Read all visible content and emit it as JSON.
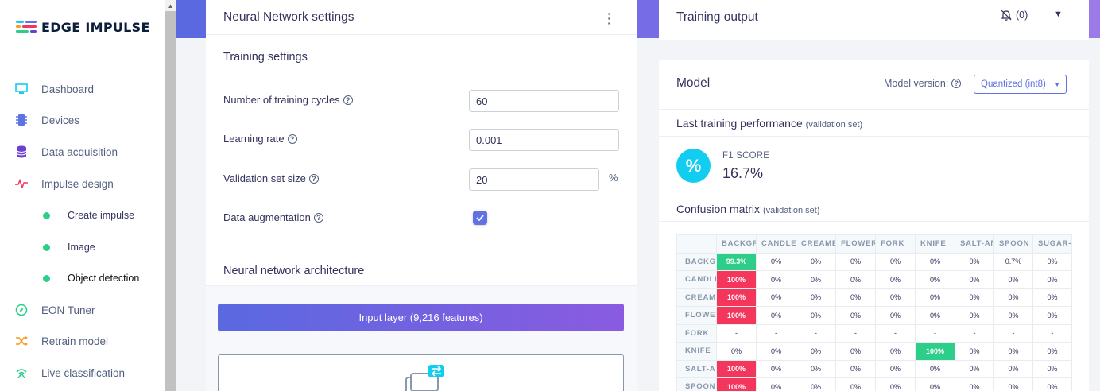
{
  "brand": {
    "name": "EDGE IMPULSE"
  },
  "sidebar": {
    "items": [
      {
        "label": "Dashboard",
        "icon": "monitor-icon",
        "color": "#11cdef"
      },
      {
        "label": "Devices",
        "icon": "chip-icon",
        "color": "#5e72e4"
      },
      {
        "label": "Data acquisition",
        "icon": "database-icon",
        "color": "#6b3fd4"
      },
      {
        "label": "Impulse design",
        "icon": "pulse-icon",
        "color": "#f5365c"
      },
      {
        "label": "Create impulse",
        "sub": true
      },
      {
        "label": "Image",
        "sub": true
      },
      {
        "label": "Object detection",
        "sub": true,
        "active": true
      },
      {
        "label": "EON Tuner",
        "icon": "compass-icon",
        "color": "#2dce89"
      },
      {
        "label": "Retrain model",
        "icon": "shuffle-icon",
        "color": "#fb9a20"
      },
      {
        "label": "Live classification",
        "icon": "signal-icon",
        "color": "#2dce89"
      }
    ]
  },
  "nn": {
    "title": "Neural Network settings",
    "training_settings": "Training settings",
    "cycles_label": "Number of training cycles",
    "cycles_value": "60",
    "lr_label": "Learning rate",
    "lr_value": "0.001",
    "val_label": "Validation set size",
    "val_value": "20",
    "val_unit": "%",
    "aug_label": "Data augmentation",
    "aug_checked": true,
    "arch_title": "Neural network architecture",
    "input_layer": "Input layer (9,216 features)"
  },
  "training_output": {
    "title": "Training output",
    "notif_count": "(0)"
  },
  "model": {
    "title": "Model",
    "version_label": "Model version:",
    "version_value": "Quantized (int8)",
    "last_perf": "Last training performance",
    "validation_note": "(validation set)",
    "f1_label": "F1 SCORE",
    "f1_value": "16.7%",
    "cm_title": "Confusion matrix",
    "cm_note": "(validation set)"
  },
  "confusion_matrix": {
    "columns": [
      "BACKGR",
      "CANDLE",
      "CREAME",
      "FLOWER",
      "FORK",
      "KNIFE",
      "SALT-AN",
      "SPOON",
      "SUGAR-I"
    ],
    "rows": [
      {
        "label": "BACKGR",
        "values": [
          "99.3%",
          "0%",
          "0%",
          "0%",
          "0%",
          "0%",
          "0%",
          "0.7%",
          "0%"
        ]
      },
      {
        "label": "CANDLE",
        "values": [
          "100%",
          "0%",
          "0%",
          "0%",
          "0%",
          "0%",
          "0%",
          "0%",
          "0%"
        ]
      },
      {
        "label": "CREAME",
        "values": [
          "100%",
          "0%",
          "0%",
          "0%",
          "0%",
          "0%",
          "0%",
          "0%",
          "0%"
        ]
      },
      {
        "label": "FLOWER",
        "values": [
          "100%",
          "0%",
          "0%",
          "0%",
          "0%",
          "0%",
          "0%",
          "0%",
          "0%"
        ]
      },
      {
        "label": "FORK",
        "values": [
          "-",
          "-",
          "-",
          "-",
          "-",
          "-",
          "-",
          "-",
          "-"
        ]
      },
      {
        "label": "KNIFE",
        "values": [
          "0%",
          "0%",
          "0%",
          "0%",
          "0%",
          "100%",
          "0%",
          "0%",
          "0%"
        ]
      },
      {
        "label": "SALT-AN",
        "values": [
          "100%",
          "0%",
          "0%",
          "0%",
          "0%",
          "0%",
          "0%",
          "0%",
          "0%"
        ]
      },
      {
        "label": "SPOON",
        "values": [
          "100%",
          "0%",
          "0%",
          "0%",
          "0%",
          "0%",
          "0%",
          "0%",
          "0%"
        ]
      }
    ],
    "hot_color": "#f5365c",
    "good_color": "#2dce89"
  }
}
